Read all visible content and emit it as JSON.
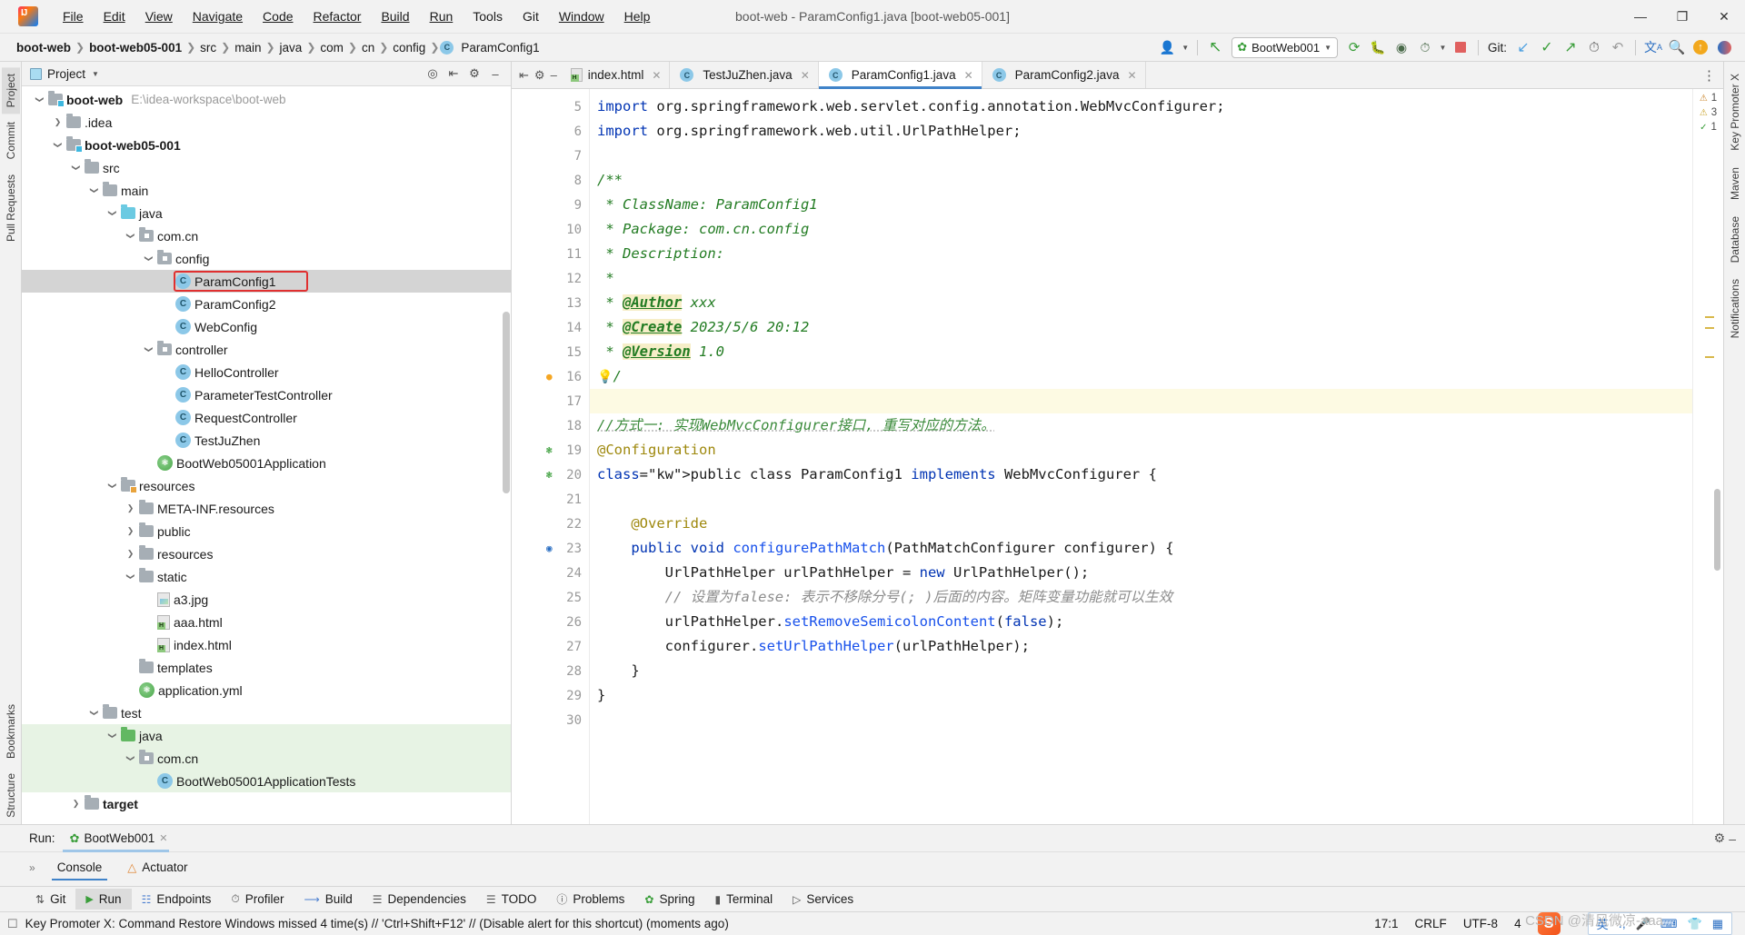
{
  "window": {
    "title": "boot-web - ParamConfig1.java [boot-web05-001]",
    "minimize": "—",
    "maximize": "❐",
    "close": "✕",
    "logo": "intellij-idea-logo"
  },
  "menubar": [
    {
      "label": "File"
    },
    {
      "label": "Edit"
    },
    {
      "label": "View"
    },
    {
      "label": "Navigate"
    },
    {
      "label": "Code"
    },
    {
      "label": "Refactor"
    },
    {
      "label": "Build"
    },
    {
      "label": "Run"
    },
    {
      "label": "Tools"
    },
    {
      "label": "Git"
    },
    {
      "label": "Window"
    },
    {
      "label": "Help"
    }
  ],
  "breadcrumb": [
    {
      "label": "boot-web",
      "bold": true
    },
    {
      "label": "boot-web05-001",
      "bold": true
    },
    {
      "label": "src",
      "bold": false
    },
    {
      "label": "main",
      "bold": false
    },
    {
      "label": "java",
      "bold": false
    },
    {
      "label": "com",
      "bold": false
    },
    {
      "label": "cn",
      "bold": false
    },
    {
      "label": "config",
      "bold": false
    },
    {
      "label": "ParamConfig1",
      "bold": false,
      "icon": "java-class-icon"
    }
  ],
  "toolbar": {
    "run_config_name": "BootWeb001",
    "run_config_icon": "spring-boot-icon",
    "profile_icon": "user-profile-icon",
    "back_icon": "back-arrow-icon",
    "run_icon": "run-icon",
    "debug_icon": "debug-icon",
    "run_with_coverage_icon": "coverage-icon",
    "profiler_icon": "profiler-icon",
    "stop_icon": "stop-icon",
    "git_label": "Git:",
    "git_update_icon": "update-project-icon",
    "git_commit_icon": "commit-icon",
    "git_push_icon": "push-icon",
    "git_history_icon": "history-icon",
    "git_rollback_icon": "rollback-icon",
    "translate_icon": "translate-icon",
    "search_icon": "search-everywhere-icon",
    "updates_icon": "updates-available-icon",
    "ide_icon": "ide-features-icon",
    "more_icon": "more-options-icon"
  },
  "left_strip": [
    {
      "label": "Project",
      "selected": true
    },
    {
      "label": "Commit",
      "selected": false
    },
    {
      "label": "Pull Requests",
      "selected": false
    },
    {
      "label": "Bookmarks",
      "selected": false
    },
    {
      "label": "Structure",
      "selected": false
    }
  ],
  "right_strip": [
    {
      "label": "Key Promoter X"
    },
    {
      "label": "Maven"
    },
    {
      "label": "Database"
    },
    {
      "label": "Notifications"
    }
  ],
  "project_panel": {
    "title": "Project",
    "actions": [
      "locate-icon",
      "collapse-all-icon",
      "settings-icon",
      "hide-icon"
    ],
    "tree": [
      {
        "depth": 0,
        "label": "boot-web",
        "path": "E:\\idea-workspace\\boot-web",
        "icon": "module-folder-icon",
        "arrow": "down",
        "bold": true
      },
      {
        "depth": 1,
        "label": ".idea",
        "icon": "folder-icon",
        "arrow": "right",
        "bold": false
      },
      {
        "depth": 1,
        "label": "boot-web05-001",
        "icon": "module-folder-icon",
        "arrow": "down",
        "bold": true
      },
      {
        "depth": 2,
        "label": "src",
        "icon": "folder-icon",
        "arrow": "down",
        "bold": false
      },
      {
        "depth": 3,
        "label": "main",
        "icon": "folder-icon",
        "arrow": "down",
        "bold": false
      },
      {
        "depth": 4,
        "label": "java",
        "icon": "source-folder-icon",
        "arrow": "down",
        "bold": false
      },
      {
        "depth": 5,
        "label": "com.cn",
        "icon": "package-icon",
        "arrow": "down",
        "bold": false
      },
      {
        "depth": 6,
        "label": "config",
        "icon": "package-icon",
        "arrow": "down",
        "bold": false
      },
      {
        "depth": 7,
        "label": "ParamConfig1",
        "icon": "java-class-icon",
        "arrow": "none",
        "bold": false,
        "selected": true,
        "highlighted": true
      },
      {
        "depth": 7,
        "label": "ParamConfig2",
        "icon": "java-class-icon",
        "arrow": "none",
        "bold": false
      },
      {
        "depth": 7,
        "label": "WebConfig",
        "icon": "java-class-icon",
        "arrow": "none",
        "bold": false
      },
      {
        "depth": 6,
        "label": "controller",
        "icon": "package-icon",
        "arrow": "down",
        "bold": false
      },
      {
        "depth": 7,
        "label": "HelloController",
        "icon": "java-class-icon",
        "arrow": "none",
        "bold": false
      },
      {
        "depth": 7,
        "label": "ParameterTestController",
        "icon": "java-class-icon",
        "arrow": "none",
        "bold": false
      },
      {
        "depth": 7,
        "label": "RequestController",
        "icon": "java-class-icon",
        "arrow": "none",
        "bold": false
      },
      {
        "depth": 7,
        "label": "TestJuZhen",
        "icon": "java-class-icon",
        "arrow": "none",
        "bold": false
      },
      {
        "depth": 6,
        "label": "BootWeb05001Application",
        "icon": "spring-class-icon",
        "arrow": "none",
        "bold": false
      },
      {
        "depth": 4,
        "label": "resources",
        "icon": "resource-folder-icon",
        "arrow": "down",
        "bold": false
      },
      {
        "depth": 5,
        "label": "META-INF.resources",
        "icon": "folder-icon",
        "arrow": "right",
        "bold": false
      },
      {
        "depth": 5,
        "label": "public",
        "icon": "folder-icon",
        "arrow": "right",
        "bold": false
      },
      {
        "depth": 5,
        "label": "resources",
        "icon": "folder-icon",
        "arrow": "right",
        "bold": false
      },
      {
        "depth": 5,
        "label": "static",
        "icon": "folder-icon",
        "arrow": "down",
        "bold": false
      },
      {
        "depth": 6,
        "label": "a3.jpg",
        "icon": "image-file-icon",
        "arrow": "none",
        "bold": false
      },
      {
        "depth": 6,
        "label": "aaa.html",
        "icon": "html-file-icon",
        "arrow": "none",
        "bold": false
      },
      {
        "depth": 6,
        "label": "index.html",
        "icon": "html-file-icon",
        "arrow": "none",
        "bold": false
      },
      {
        "depth": 5,
        "label": "templates",
        "icon": "folder-icon",
        "arrow": "none",
        "bold": false
      },
      {
        "depth": 5,
        "label": "application.yml",
        "icon": "spring-yaml-icon",
        "arrow": "none",
        "bold": false
      },
      {
        "depth": 3,
        "label": "test",
        "icon": "folder-icon",
        "arrow": "down",
        "bold": false
      },
      {
        "depth": 4,
        "label": "java",
        "icon": "test-source-folder-icon",
        "arrow": "down",
        "bold": false,
        "green": true
      },
      {
        "depth": 5,
        "label": "com.cn",
        "icon": "package-icon",
        "arrow": "down",
        "bold": false,
        "green": true
      },
      {
        "depth": 6,
        "label": "BootWeb05001ApplicationTests",
        "icon": "java-class-icon",
        "arrow": "none",
        "bold": false,
        "green": true
      },
      {
        "depth": 2,
        "label": "target",
        "icon": "folder-icon",
        "arrow": "right",
        "bold": true
      }
    ]
  },
  "editor": {
    "tabs": [
      {
        "label": "index.html",
        "icon": "html-file-icon",
        "active": false
      },
      {
        "label": "TestJuZhen.java",
        "icon": "java-class-icon",
        "active": false
      },
      {
        "label": "ParamConfig1.java",
        "icon": "java-class-icon",
        "active": true
      },
      {
        "label": "ParamConfig2.java",
        "icon": "java-class-icon",
        "active": false
      }
    ],
    "tab_actions": [
      "more-tabs-icon"
    ],
    "inspections": {
      "warnings": "1",
      "weak_warnings": "3",
      "typos": "1",
      "warning_icon": "warning-triangle-icon",
      "weak_warning_icon": "weak-warning-icon",
      "typo_icon": "typo-icon",
      "collapse_icon": "chevron-up-icon",
      "expand_icon": "chevron-down-icon"
    },
    "first_line": 5,
    "lines": [
      {
        "n": 5,
        "text": "import org.springframework.web.servlet.config.annotation.WebMvcConfigurer;"
      },
      {
        "n": 6,
        "text": "import org.springframework.web.util.UrlPathHelper;"
      },
      {
        "n": 7,
        "text": ""
      },
      {
        "n": 8,
        "text": "/**"
      },
      {
        "n": 9,
        "text": " * ClassName: ParamConfig1"
      },
      {
        "n": 10,
        "text": " * Package: com.cn.config"
      },
      {
        "n": 11,
        "text": " * Description:"
      },
      {
        "n": 12,
        "text": " *"
      },
      {
        "n": 13,
        "text": " * @Author xxx"
      },
      {
        "n": 14,
        "text": " * @Create 2023/5/6 20:12"
      },
      {
        "n": 15,
        "text": " * @Version 1.0"
      },
      {
        "n": 16,
        "text": " */"
      },
      {
        "n": 17,
        "text": ""
      },
      {
        "n": 18,
        "text": "//方式一: 实现WebMvcConfigurer接口, 重写对应的方法。"
      },
      {
        "n": 19,
        "text": "@Configuration"
      },
      {
        "n": 20,
        "text": "public class ParamConfig1 implements WebMvcConfigurer {"
      },
      {
        "n": 21,
        "text": ""
      },
      {
        "n": 22,
        "text": "    @Override"
      },
      {
        "n": 23,
        "text": "    public void configurePathMatch(PathMatchConfigurer configurer) {"
      },
      {
        "n": 24,
        "text": "        UrlPathHelper urlPathHelper = new UrlPathHelper();"
      },
      {
        "n": 25,
        "text": "        // 设置为falese: 表示不移除分号(; )后面的内容。矩阵变量功能就可以生效"
      },
      {
        "n": 26,
        "text": "        urlPathHelper.setRemoveSemicolonContent(false);"
      },
      {
        "n": 27,
        "text": "        configurer.setUrlPathHelper(urlPathHelper);"
      },
      {
        "n": 28,
        "text": "    }"
      },
      {
        "n": 29,
        "text": "}"
      },
      {
        "n": 30,
        "text": ""
      }
    ]
  },
  "run_panel": {
    "label": "Run:",
    "config_name": "BootWeb001",
    "config_icon": "spring-boot-icon",
    "close_icon": "close-icon",
    "settings_icon": "gear-icon",
    "hide_icon": "hide-icon",
    "expander": "»",
    "tabs": [
      {
        "label": "Console",
        "icon": "console-icon",
        "selected": true
      },
      {
        "label": "Actuator",
        "icon": "actuator-icon",
        "selected": false
      }
    ]
  },
  "tool_strip": [
    {
      "label": "Git",
      "icon": "git-icon",
      "selected": false
    },
    {
      "label": "Run",
      "icon": "run-icon",
      "selected": true
    },
    {
      "label": "Endpoints",
      "icon": "endpoints-icon",
      "selected": false
    },
    {
      "label": "Profiler",
      "icon": "profiler-icon",
      "selected": false
    },
    {
      "label": "Build",
      "icon": "build-icon",
      "selected": false
    },
    {
      "label": "Dependencies",
      "icon": "dependencies-icon",
      "selected": false
    },
    {
      "label": "TODO",
      "icon": "todo-icon",
      "selected": false
    },
    {
      "label": "Problems",
      "icon": "problems-icon",
      "selected": false
    },
    {
      "label": "Spring",
      "icon": "spring-icon",
      "selected": false
    },
    {
      "label": "Terminal",
      "icon": "terminal-icon",
      "selected": false
    },
    {
      "label": "Services",
      "icon": "services-icon",
      "selected": false
    }
  ],
  "statusbar": {
    "icon": "event-log-icon",
    "message": "Key Promoter X: Command Restore Windows missed 4 time(s) // 'Ctrl+Shift+F12' // (Disable alert for this shortcut) (moments ago)",
    "caret_position": "17:1",
    "line_separator": "CRLF",
    "encoding": "UTF-8",
    "indent": "4",
    "watermark": "CSDN @清风微凉-aaa",
    "ime": {
      "app_icon": "sogou-input-icon",
      "app_glyph": "S",
      "mode": "英",
      "items": [
        "voice-icon",
        "keyboard-icon",
        "skin-icon",
        "apps-icon"
      ]
    }
  },
  "colors": {
    "accent": "#4083c9",
    "selection": "#d4d4d4",
    "test_green": "#e7f3e4",
    "highlight_box": "#e03030",
    "keyword": "#0033b3",
    "string": "#067d17",
    "javadoc": "#237c23",
    "annotation": "#9e880d",
    "method": "#1750eb"
  }
}
